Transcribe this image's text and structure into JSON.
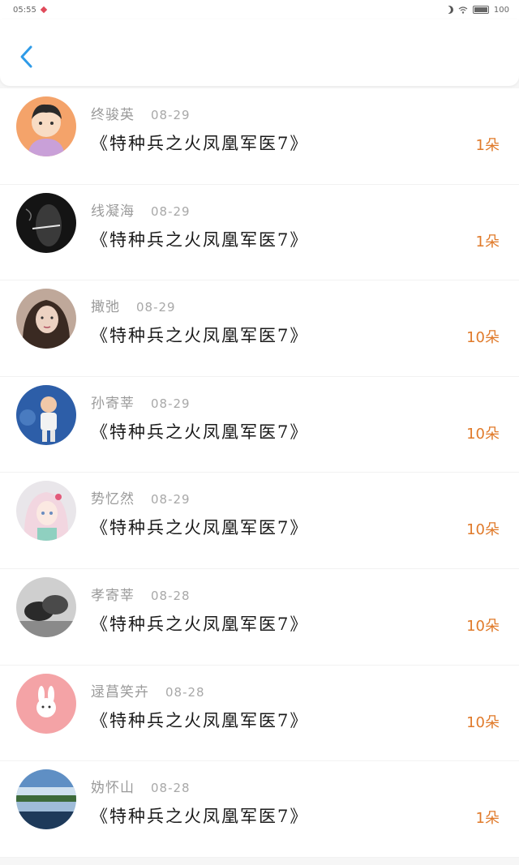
{
  "status_bar": {
    "time": "05:55",
    "battery": "100"
  },
  "header": {
    "back_icon": "chevron-left-icon",
    "accent_color": "#2f9be8"
  },
  "gifts": [
    {
      "name": "终骏英",
      "date": "08-29",
      "title": "《特种兵之火凤凰军医7》",
      "count": "1朵",
      "avatar": "cartoon-boy"
    },
    {
      "name": "线凝海",
      "date": "08-29",
      "title": "《特种兵之火凤凰军医7》",
      "count": "1朵",
      "avatar": "dark-smoke"
    },
    {
      "name": "撖弛",
      "date": "08-29",
      "title": "《特种兵之火凤凰军医7》",
      "count": "10朵",
      "avatar": "girl-portrait"
    },
    {
      "name": "孙寄莘",
      "date": "08-29",
      "title": "《特种兵之火凤凰军医7》",
      "count": "10朵",
      "avatar": "baby-photo"
    },
    {
      "name": "势忆然",
      "date": "08-29",
      "title": "《特种兵之火凤凰军医7》",
      "count": "10朵",
      "avatar": "anime-girl"
    },
    {
      "name": "孝寄莘",
      "date": "08-28",
      "title": "《特种兵之火凤凰军医7》",
      "count": "10朵",
      "avatar": "bw-couple"
    },
    {
      "name": "逯菖笑卉",
      "date": "08-28",
      "title": "《特种兵之火凤凰军医7》",
      "count": "10朵",
      "avatar": "pink-bunny"
    },
    {
      "name": "妫怀山",
      "date": "08-28",
      "title": "《特种兵之火凤凰军医7》",
      "count": "1朵",
      "avatar": "landscape"
    }
  ]
}
